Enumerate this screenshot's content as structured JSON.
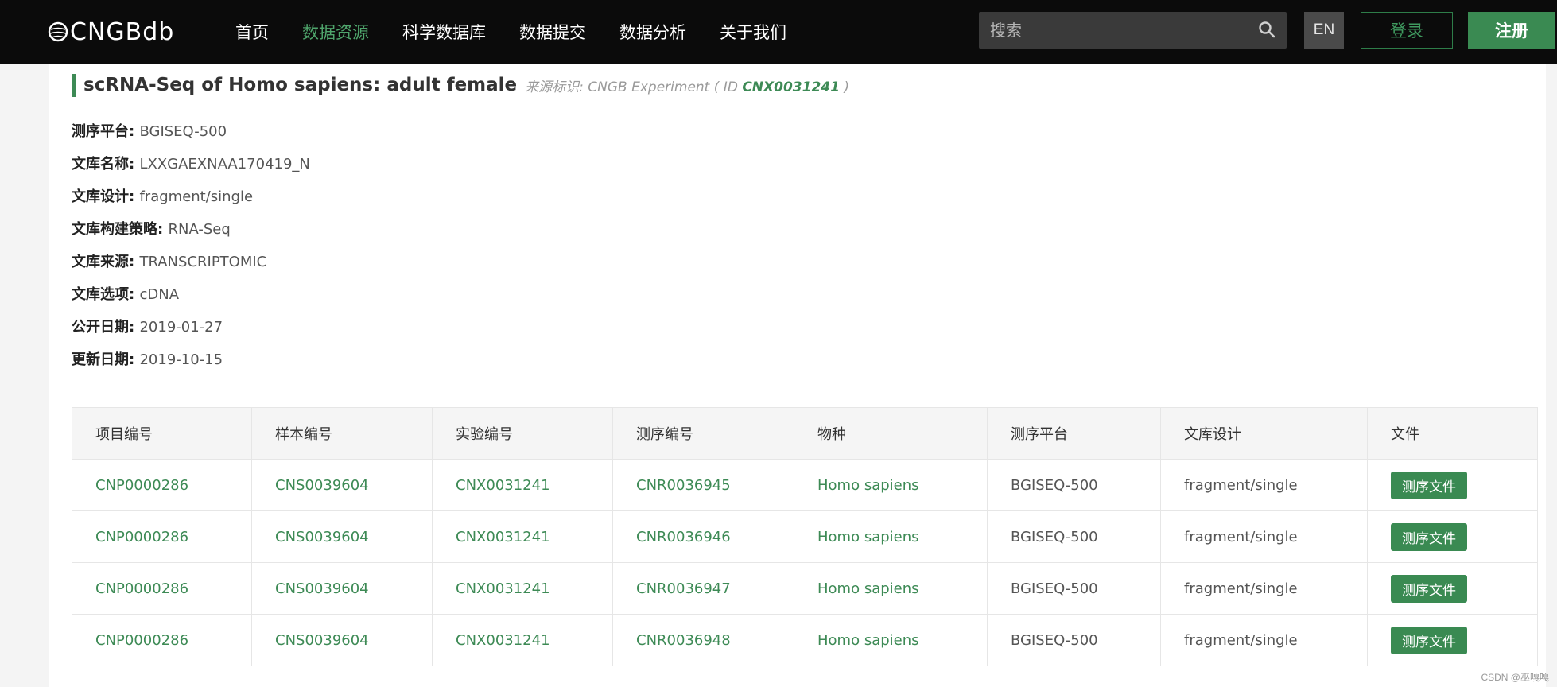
{
  "header": {
    "logo": "CNGBdb",
    "nav": [
      {
        "label": "首页"
      },
      {
        "label": "数据资源",
        "active": true
      },
      {
        "label": "科学数据库"
      },
      {
        "label": "数据提交"
      },
      {
        "label": "数据分析"
      },
      {
        "label": "关于我们"
      }
    ],
    "search_placeholder": "搜索",
    "lang_button": "EN",
    "login_button": "登录",
    "register_button": "注册"
  },
  "experiment": {
    "title": "scRNA-Seq of Homo sapiens: adult female",
    "source_label": "来源标识:",
    "source_name": "CNGB Experiment",
    "id_prefix": "( ID",
    "id": "CNX0031241",
    "id_suffix": ")"
  },
  "properties": [
    {
      "key": "测序平台",
      "value": "BGISEQ-500"
    },
    {
      "key": "文库名称",
      "value": "LXXGAEXNAA170419_N"
    },
    {
      "key": "文库设计",
      "value": "fragment/single"
    },
    {
      "key": "文库构建策略",
      "value": "RNA-Seq"
    },
    {
      "key": "文库来源",
      "value": "TRANSCRIPTOMIC"
    },
    {
      "key": "文库选项",
      "value": "cDNA"
    },
    {
      "key": "公开日期",
      "value": "2019-01-27"
    },
    {
      "key": "更新日期",
      "value": "2019-10-15"
    }
  ],
  "table": {
    "columns": [
      "项目编号",
      "样本编号",
      "实验编号",
      "测序编号",
      "物种",
      "测序平台",
      "文库设计",
      "文件"
    ],
    "file_button_label": "测序文件",
    "rows": [
      [
        "CNP0000286",
        "CNS0039604",
        "CNX0031241",
        "CNR0036945",
        "Homo sapiens",
        "BGISEQ-500",
        "fragment/single"
      ],
      [
        "CNP0000286",
        "CNS0039604",
        "CNX0031241",
        "CNR0036946",
        "Homo sapiens",
        "BGISEQ-500",
        "fragment/single"
      ],
      [
        "CNP0000286",
        "CNS0039604",
        "CNX0031241",
        "CNR0036947",
        "Homo sapiens",
        "BGISEQ-500",
        "fragment/single"
      ],
      [
        "CNP0000286",
        "CNS0039604",
        "CNX0031241",
        "CNR0036948",
        "Homo sapiens",
        "BGISEQ-500",
        "fragment/single"
      ]
    ]
  },
  "watermark": "CSDN @巫嘎嘎",
  "colors": {
    "accent": "#3d8a55",
    "nav_active": "#4fa56c",
    "topbar": "#0b0b0b"
  }
}
